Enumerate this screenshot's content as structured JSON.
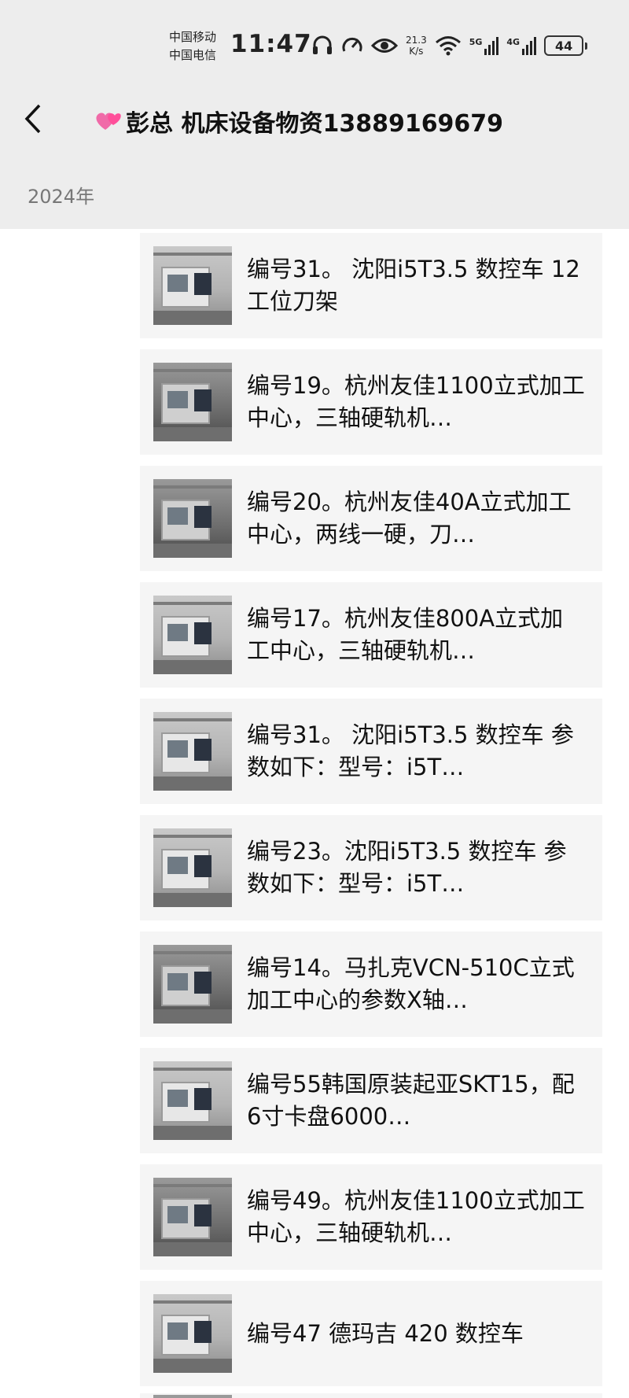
{
  "status_bar": {
    "carrier_1": "中国移动",
    "carrier_2": "中国电信",
    "time": "11:47",
    "net_speed_value": "21.3",
    "net_speed_unit": "K/s",
    "signal_1_label": "5G",
    "signal_2_label": "4G",
    "battery": "44"
  },
  "header": {
    "title": "彭总 机床设备物资13889169679",
    "title_emoji": "heart-icon"
  },
  "section": {
    "year": "2024年"
  },
  "items": [
    {
      "text": "编号31。 沈阳i5T3.5 数控车 12工位刀架"
    },
    {
      "text": "编号19。杭州友佳1100立式加工中心，三轴硬轨机…"
    },
    {
      "text": "编号20。杭州友佳40A立式加工中心，两线一硬，刀…"
    },
    {
      "text": "编号17。杭州友佳800A立式加工中心，三轴硬轨机…"
    },
    {
      "text": "编号31。 沈阳i5T3.5 数控车 参数如下：型号：i5T…"
    },
    {
      "text": "编号23。沈阳i5T3.5 数控车 参数如下：型号：i5T…"
    },
    {
      "text": "编号14。马扎克VCN-510C立式加工中心的参数X轴…"
    },
    {
      "text": "编号55韩国原装起亚SKT15，配6寸卡盘6000…"
    },
    {
      "text": "编号49。杭州友佳1100立式加工中心，三轴硬轨机…"
    },
    {
      "text": "编号47 德玛吉 420 数控车"
    }
  ]
}
